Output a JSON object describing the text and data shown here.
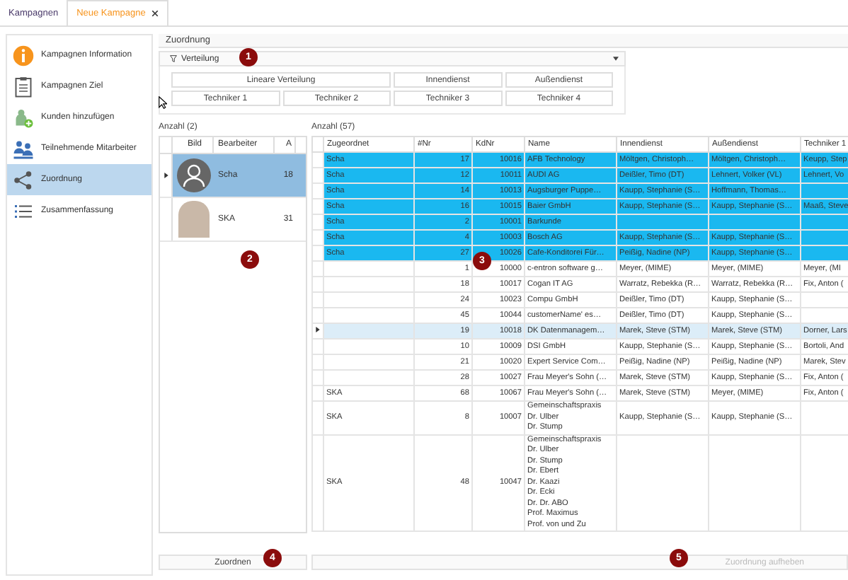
{
  "tabs": [
    {
      "label": "Kampagnen",
      "selected": false,
      "closable": false
    },
    {
      "label": "Neue Kampagne",
      "selected": true,
      "closable": true
    }
  ],
  "sidebar": {
    "items": [
      {
        "label": "Kampagnen Information",
        "kind": "info",
        "selected": false
      },
      {
        "label": "Kampagnen Ziel",
        "kind": "clipboard",
        "selected": false
      },
      {
        "label": "Kunden hinzufügen",
        "kind": "add-person",
        "selected": false
      },
      {
        "label": "Teilnehmende Mitarbeiter",
        "kind": "team",
        "selected": false
      },
      {
        "label": "Zuordnung",
        "kind": "share",
        "selected": true
      },
      {
        "label": "Zusammenfassung",
        "kind": "list",
        "selected": false
      }
    ]
  },
  "section_title": "Zuordnung",
  "distribution": {
    "label": "Verteilung",
    "buttons": [
      {
        "label": "Lineare Verteilung",
        "wide": true
      },
      {
        "label": "Innendienst",
        "wide": false
      },
      {
        "label": "Außendienst",
        "wide": false
      },
      {
        "label": "Techniker 1",
        "wide": false
      },
      {
        "label": "Techniker 2",
        "wide": false
      },
      {
        "label": "Techniker 3",
        "wide": false
      },
      {
        "label": "Techniker 4",
        "wide": false
      }
    ]
  },
  "left_grid": {
    "count_label": "Anzahl (2)",
    "columns": [
      "Bild",
      "Bearbeiter",
      "A"
    ],
    "rows": [
      {
        "kind": "avatar",
        "worker": "Scha",
        "count": "18",
        "selected": true,
        "focused": true
      },
      {
        "kind": "photo",
        "worker": "SKA",
        "count": "31",
        "selected": false,
        "focused": false
      }
    ]
  },
  "grid": {
    "count_label": "Anzahl (57)",
    "columns": [
      "Zugeordnet",
      "#Nr",
      "KdNr",
      "Name",
      "Innendienst",
      "Außendienst",
      "Techniker 1"
    ],
    "rows": [
      {
        "cells": [
          "Scha",
          "17",
          "10016",
          "AFB Technology",
          "Möltgen, Christoph…",
          "Möltgen, Christoph…",
          "Keupp, Step"
        ],
        "selected": true,
        "focused": false
      },
      {
        "cells": [
          "Scha",
          "12",
          "10011",
          "AUDI AG",
          "Deißler, Timo (DT)",
          "Lehnert, Volker (VL)",
          "Lehnert, Vo"
        ],
        "selected": true,
        "focused": false
      },
      {
        "cells": [
          "Scha",
          "14",
          "10013",
          "Augsburger Puppe…",
          "Kaupp, Stephanie (S…",
          "Hoffmann, Thomas…",
          null
        ],
        "selected": true,
        "focused": false
      },
      {
        "cells": [
          "Scha",
          "16",
          "10015",
          "Baier GmbH",
          "Kaupp, Stephanie (S…",
          "Kaupp, Stephanie (S…",
          "Maaß, Steve"
        ],
        "selected": true,
        "focused": false
      },
      {
        "cells": [
          "Scha",
          "2",
          "10001",
          "Barkunde",
          null,
          null,
          null
        ],
        "selected": true,
        "focused": false
      },
      {
        "cells": [
          "Scha",
          "4",
          "10003",
          "Bosch AG",
          "Kaupp, Stephanie (S…",
          "Kaupp, Stephanie (S…",
          null
        ],
        "selected": true,
        "focused": false
      },
      {
        "cells": [
          "Scha",
          "27",
          "10026",
          "Cafe-Konditorei Für…",
          "Peißig, Nadine (NP)",
          "Kaupp, Stephanie (S…",
          null
        ],
        "selected": true,
        "focused": false
      },
      {
        "cells": [
          null,
          "1",
          "10000",
          "c-entron software g…",
          "Meyer,  (MIME)",
          "Meyer,  (MIME)",
          "Meyer,  (MI"
        ],
        "selected": false,
        "focused": false
      },
      {
        "cells": [
          null,
          "18",
          "10017",
          "Cogan IT AG",
          "Warratz, Rebekka (R…",
          "Warratz, Rebekka (R…",
          "Fix, Anton ("
        ],
        "selected": false,
        "focused": false
      },
      {
        "cells": [
          null,
          "24",
          "10023",
          "Compu GmbH",
          "Deißler, Timo (DT)",
          "Kaupp, Stephanie (S…",
          null
        ],
        "selected": false,
        "focused": false
      },
      {
        "cells": [
          null,
          "45",
          "10044",
          "customerName' es…",
          "Deißler, Timo (DT)",
          "Kaupp, Stephanie (S…",
          null
        ],
        "selected": false,
        "focused": false
      },
      {
        "cells": [
          null,
          "19",
          "10018",
          "DK Datenmanagem…",
          "Marek, Steve (STM)",
          "Marek, Steve (STM)",
          "Dorner, Lars"
        ],
        "selected": false,
        "focused": true
      },
      {
        "cells": [
          null,
          "10",
          "10009",
          "DSI GmbH",
          "Kaupp, Stephanie (S…",
          "Kaupp, Stephanie (S…",
          "Bortoli, And"
        ],
        "selected": false,
        "focused": false
      },
      {
        "cells": [
          null,
          "21",
          "10020",
          "Expert Service Com…",
          "Peißig, Nadine (NP)",
          "Peißig, Nadine (NP)",
          "Marek, Stev"
        ],
        "selected": false,
        "focused": false
      },
      {
        "cells": [
          null,
          "28",
          "10027",
          "Frau Meyer's Sohn (…",
          "Marek, Steve (STM)",
          "Kaupp, Stephanie (S…",
          "Fix, Anton ("
        ],
        "selected": false,
        "focused": false
      },
      {
        "cells": [
          "SKA",
          "68",
          "10067",
          "Frau Meyer's Sohn (…",
          "Marek, Steve (STM)",
          "Meyer,  (MIME)",
          "Fix, Anton ("
        ],
        "selected": false,
        "focused": false
      },
      {
        "cells": [
          "SKA",
          "8",
          "10007",
          "Gemeinschaftspraxis\nDr. Ulber\nDr. Stump",
          "Kaupp, Stephanie (S…",
          "Kaupp, Stephanie (S…",
          null
        ],
        "selected": false,
        "focused": false
      },
      {
        "cells": [
          "SKA",
          "48",
          "10047",
          "Gemeinschaftspraxis\nDr. Ulber\nDr. Stump\nDr. Ebert\nDr. Kaazi\nDr. Ecki\nDr. Dr. ABO\nProf. Maximus\nProf. von und Zu",
          null,
          null,
          null
        ],
        "selected": false,
        "focused": false
      }
    ]
  },
  "actions": [
    {
      "label": "Zuordnen",
      "disabled": false
    },
    {
      "label": "Zuordnung aufheben",
      "disabled": true
    }
  ],
  "badges": [
    "1",
    "2",
    "3",
    "4",
    "5"
  ]
}
